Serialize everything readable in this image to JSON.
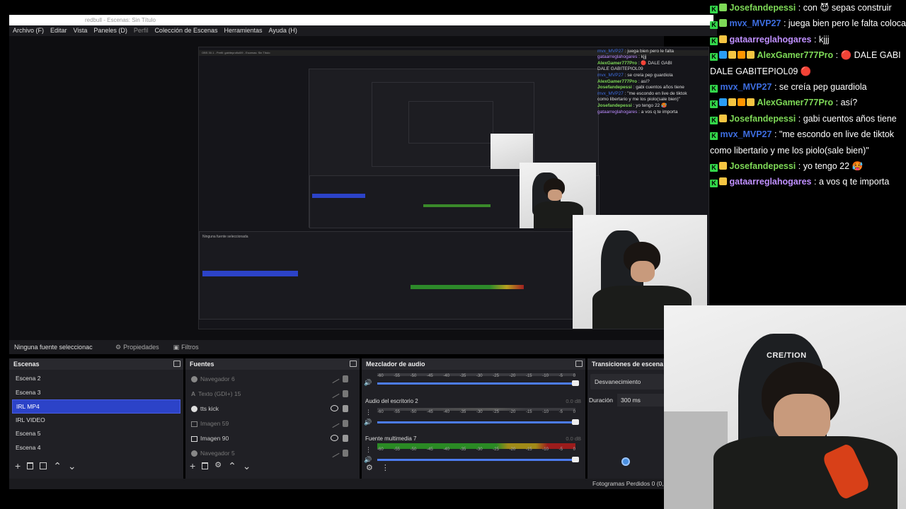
{
  "window": {
    "title": "redbull - Escenas: Sin Título"
  },
  "menu": [
    "Archivo (F)",
    "Editar",
    "Vista",
    "Paneles (D)",
    "Perfil",
    "Colección de Escenas",
    "Herramientas",
    "Ayuda (H)"
  ],
  "properties_bar": {
    "no_source": "Ninguna fuente seleccionac",
    "properties": "Propiedades",
    "filters": "Filtros"
  },
  "scenes": {
    "title": "Escenas",
    "items": [
      "Escena 2",
      "Escena 3",
      "IRL MP4",
      "IRL VIDEO",
      "Escena 5",
      "Escena 4"
    ],
    "selected": "IRL MP4"
  },
  "sources": {
    "title": "Fuentes",
    "items": [
      {
        "name": "Navegador 6",
        "visible": false
      },
      {
        "name": "Texto (GDI+) 15",
        "visible": false
      },
      {
        "name": "tts kick",
        "visible": true
      },
      {
        "name": "Imagen 59",
        "visible": false
      },
      {
        "name": "Imagen 90",
        "visible": true
      },
      {
        "name": "Navegador 5",
        "visible": false
      }
    ]
  },
  "mixer": {
    "title": "Mezclador de audio",
    "scale": [
      "-60",
      "-55",
      "-50",
      "-45",
      "-40",
      "-35",
      "-30",
      "-25",
      "-20",
      "-15",
      "-10",
      "-5",
      "0"
    ],
    "channels": [
      {
        "name": "",
        "db": ""
      },
      {
        "name": "Audio del escritorio 2",
        "db": "0.0 dB"
      },
      {
        "name": "Fuente multimedia 7",
        "db": "0.0 dB"
      }
    ]
  },
  "transitions": {
    "title": "Transiciones de escena",
    "type": "Desvanecimiento",
    "duration_label": "Duración",
    "duration_value": "300 ms"
  },
  "status": {
    "dropped_frames": "Fotogramas Perdidos 0 (0,"
  },
  "chat": [
    {
      "user": "Josefandepessi",
      "color": "#7ed957",
      "badges": [
        "#7ed957"
      ],
      "text": ": con 😈 sepas construir"
    },
    {
      "user": "mvx_MVP27",
      "color": "#3d6de0",
      "badges": [
        "#7ed957"
      ],
      "text": ": juega bien pero le falta coloca"
    },
    {
      "user": "gataarreglahogares",
      "color": "#c090ff",
      "badges": [
        "#f5c542"
      ],
      "text": ": kjjj"
    },
    {
      "user": "AlexGamer777Pro",
      "color": "#7ed957",
      "badges": [
        "#2a9df4",
        "#f5c542",
        "#ff9500",
        "#f5c542"
      ],
      "text": ": 🔴 DALE GABI"
    },
    {
      "user": "",
      "color": "#fff",
      "badges": [],
      "text": "DALE GABITEPIOL09 🔴"
    },
    {
      "user": "mvx_MVP27",
      "color": "#3d6de0",
      "badges": [],
      "text": ": se creía pep guardiola"
    },
    {
      "user": "AlexGamer777Pro",
      "color": "#7ed957",
      "badges": [
        "#2a9df4",
        "#f5c542",
        "#ff9500",
        "#f5c542"
      ],
      "text": ": así?"
    },
    {
      "user": "Josefandepessi",
      "color": "#7ed957",
      "badges": [
        "#f5c542"
      ],
      "text": ": gabi cuentos años tiene"
    },
    {
      "user": "mvx_MVP27",
      "color": "#3d6de0",
      "badges": [],
      "text": ": \"me escondo en live de tiktok"
    },
    {
      "user": "",
      "color": "#fff",
      "badges": [],
      "text": "como libertario y me los piolo(sale bien)\""
    },
    {
      "user": "Josefandepessi",
      "color": "#7ed957",
      "badges": [
        "#f5c542"
      ],
      "text": ": yo tengo 22 🥵"
    },
    {
      "user": "gataarreglahogares",
      "color": "#c090ff",
      "badges": [
        "#f5c542"
      ],
      "text": ": a vos q te importa"
    }
  ],
  "icons": {
    "kick_badge": "K",
    "gear": "⚙",
    "filter": "▣",
    "add": "+",
    "trash": "🗑",
    "up": "⌃",
    "down": "⌄",
    "speaker": "🔊",
    "more": "⋮"
  }
}
